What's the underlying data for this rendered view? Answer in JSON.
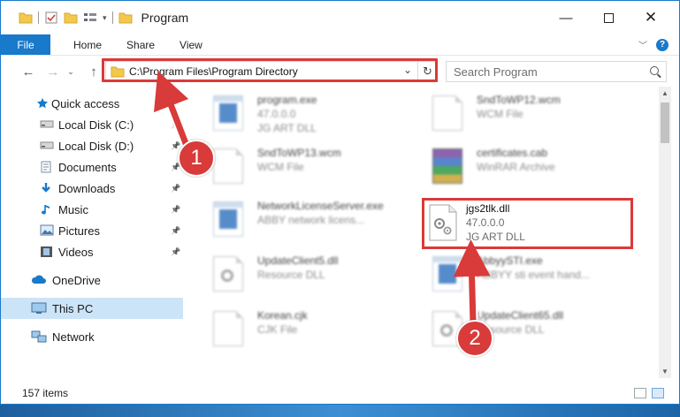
{
  "window": {
    "title": "Program"
  },
  "ribbon": {
    "file": "File",
    "tabs": [
      "Home",
      "Share",
      "View"
    ]
  },
  "nav": {
    "address": "C:\\Program Files\\Program Directory",
    "search_placeholder": "Search Program"
  },
  "sidebar": {
    "items": [
      {
        "label": "Quick access",
        "icon": "star-icon"
      },
      {
        "label": "Local Disk (C:)",
        "icon": "drive-icon",
        "pinned": true
      },
      {
        "label": "Local Disk (D:)",
        "icon": "drive-icon",
        "pinned": true
      },
      {
        "label": "Documents",
        "icon": "documents-icon",
        "pinned": true
      },
      {
        "label": "Downloads",
        "icon": "downloads-icon",
        "pinned": true
      },
      {
        "label": "Music",
        "icon": "music-icon",
        "pinned": true
      },
      {
        "label": "Pictures",
        "icon": "pictures-icon",
        "pinned": true
      },
      {
        "label": "Videos",
        "icon": "videos-icon",
        "pinned": true
      },
      {
        "label": "OneDrive",
        "icon": "cloud-icon"
      },
      {
        "label": "This PC",
        "icon": "computer-icon",
        "selected": true
      },
      {
        "label": "Network",
        "icon": "network-icon"
      }
    ]
  },
  "files": [
    {
      "name": "program.exe",
      "line1": "47.0.0.0",
      "line2": "JG ART DLL"
    },
    {
      "name": "SndToWP12.wcm",
      "line1": "WCM File",
      "line2": ""
    },
    {
      "name": "SndToWP13.wcm",
      "line1": "WCM File",
      "line2": ""
    },
    {
      "name": "certificates.cab",
      "line1": "WinRAR Archive",
      "line2": ""
    },
    {
      "name": "NetworkLicenseServer.exe",
      "line1": "ABBY network licens...",
      "line2": ""
    },
    {
      "name": "jgs2tlk.dll",
      "line1": "47.0.0.0",
      "line2": "JG ART DLL"
    },
    {
      "name": "UpdateClient5.dll",
      "line1": "Resource DLL",
      "line2": ""
    },
    {
      "name": "AbbyySTI.exe",
      "line1": "ABBYY sti event hand...",
      "line2": ""
    },
    {
      "name": "Korean.cjk",
      "line1": "CJK File",
      "line2": ""
    },
    {
      "name": "UpdateClient65.dll",
      "line1": "Resource DLL",
      "line2": ""
    }
  ],
  "status": {
    "count": "157 items"
  },
  "callouts": [
    "1",
    "2"
  ],
  "colors": {
    "accent": "#1979ca",
    "highlight": "#d93a3a",
    "selected": "#cce4f7"
  }
}
